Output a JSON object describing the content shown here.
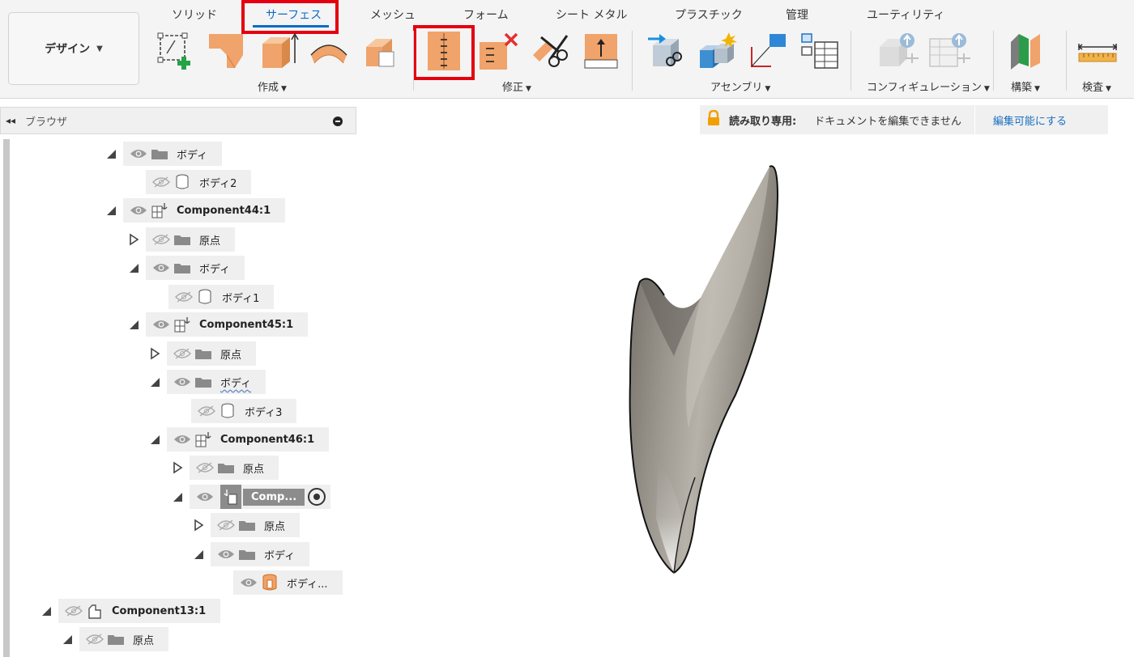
{
  "design_button": {
    "label": "デザイン"
  },
  "tabs": [
    {
      "label": "ソリッド"
    },
    {
      "label": "サーフェス",
      "active": true
    },
    {
      "label": "メッシュ"
    },
    {
      "label": "フォーム"
    },
    {
      "label": "シート メタル"
    },
    {
      "label": "プラスチック"
    },
    {
      "label": "管理"
    },
    {
      "label": "ユーティリティ"
    }
  ],
  "groups": [
    {
      "label": "作成"
    },
    {
      "label": "修正"
    },
    {
      "label": "アセンブリ"
    },
    {
      "label": "コンフィギュレーション"
    },
    {
      "label": "構築"
    },
    {
      "label": "検査"
    }
  ],
  "tool_icons": [
    "create-sketch-icon",
    "extrude-icon",
    "thicken-icon",
    "revolve-sweep-icon",
    "patch-icon",
    "stitch-icon",
    "unstitch-icon",
    "trim-icon",
    "extend-icon",
    "new-component-icon",
    "joint-icon",
    "rigid-group-icon",
    "table-icon",
    "configure-icon",
    "config-table-icon",
    "offset-plane-icon",
    "measure-icon"
  ],
  "highlights": {
    "active_tab": "サーフェス",
    "highlighted_tool": "stitch-icon",
    "color": "#e40010"
  },
  "browser": {
    "title": "ブラウザ",
    "nodes": [
      {
        "label": "ボディ"
      },
      {
        "label": "ボディ2"
      },
      {
        "label": "Component44:1"
      },
      {
        "label": "原点"
      },
      {
        "label": "ボディ"
      },
      {
        "label": "ボディ1"
      },
      {
        "label": "Component45:1"
      },
      {
        "label": "原点"
      },
      {
        "label": "ボディ"
      },
      {
        "label": "ボディ3"
      },
      {
        "label": "Component46:1"
      },
      {
        "label": "原点"
      },
      {
        "label": "Comp..."
      },
      {
        "label": "原点"
      },
      {
        "label": "ボディ"
      },
      {
        "label": "ボディ..."
      },
      {
        "label": "Component13:1"
      },
      {
        "label": "原点"
      }
    ]
  },
  "readonly": {
    "label": "読み取り専用:",
    "message": "ドキュメントを編集できません",
    "action": "編集可能にする"
  },
  "colors": {
    "accent": "#0d6cc6",
    "tool_orange": "#f0a36a",
    "ribbon_bg": "#f4f4f4",
    "surface_body": "#8f8b83"
  }
}
